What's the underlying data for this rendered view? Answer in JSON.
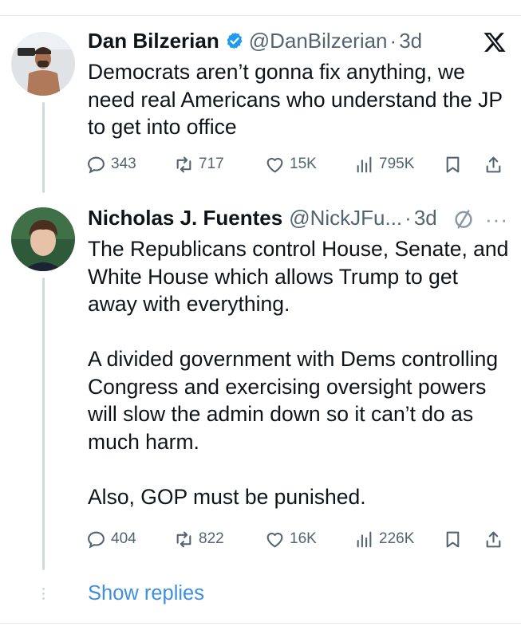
{
  "tweets": [
    {
      "name": "Dan Bilzerian",
      "verified": true,
      "handle": "@DanBilzerian",
      "sep": "·",
      "time": "3d",
      "body": [
        "Democrats aren’t gonna fix anything, we need real Americans who understand the JP to get into office"
      ],
      "stats": {
        "replies": "343",
        "reposts": "717",
        "likes": "15K",
        "views": "795K"
      }
    },
    {
      "name": "Nicholas J. Fuentes",
      "verified": false,
      "handle": "@NickJFu...",
      "sep": "·",
      "time": "3d",
      "more": "···",
      "body": [
        "The Republicans control House, Senate, and White House which allows Trump to get away with everything.",
        "A divided government with Dems controlling Congress and exercising oversight powers will slow the admin down so it can’t do as much harm.",
        "Also, GOP must be punished."
      ],
      "stats": {
        "replies": "404",
        "reposts": "822",
        "likes": "16K",
        "views": "226K"
      }
    }
  ],
  "show_replies": "Show replies",
  "icons": {
    "brand": "x-logo-icon",
    "reply": "reply-icon",
    "repost": "repost-icon",
    "like": "heart-icon",
    "views": "views-icon",
    "bookmark": "bookmark-icon",
    "share": "share-icon",
    "grok": "no-circle-icon",
    "more": "more-icon"
  },
  "colors": {
    "text": "#0f1419",
    "muted": "#536471",
    "link": "#3f8fe0",
    "verified": "#1d9bf0"
  }
}
